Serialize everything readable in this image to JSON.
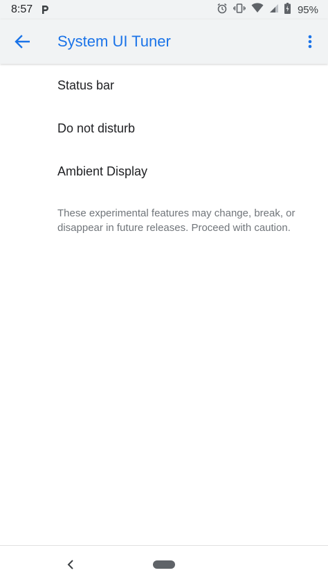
{
  "status_bar": {
    "time": "8:57",
    "notification_icon": "parking-p-icon",
    "icons": [
      "alarm-icon",
      "vibrate-icon",
      "wifi-icon",
      "signal-icon",
      "battery-charging-icon"
    ],
    "battery_percent": "95%"
  },
  "app_bar": {
    "title": "System UI Tuner",
    "back_icon": "arrow-back-icon",
    "menu_icon": "more-vert-icon",
    "accent_color": "#1a73e8"
  },
  "list": {
    "items": [
      {
        "label": "Status bar"
      },
      {
        "label": "Do not disturb"
      },
      {
        "label": "Ambient Display"
      }
    ]
  },
  "footer": {
    "text": "These experimental features may change, break, or disappear in future releases. Proceed with caution."
  },
  "nav_bar": {
    "back_icon": "nav-back-icon",
    "home_icon": "nav-home-pill"
  }
}
